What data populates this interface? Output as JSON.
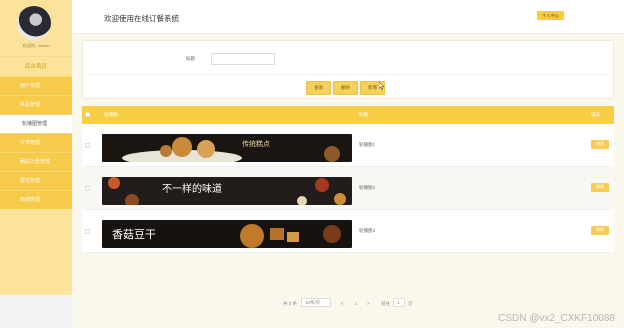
{
  "sidebar": {
    "profile_name": "欢迎你，admin",
    "home_label": "后台首页",
    "items": [
      {
        "label": "用户管理"
      },
      {
        "label": "菜品管理"
      },
      {
        "label": "轮播图管理"
      },
      {
        "label": "订单管理"
      },
      {
        "label": "网站公告管理"
      },
      {
        "label": "留言管理"
      },
      {
        "label": "商城管理"
      }
    ]
  },
  "header": {
    "title": "欢迎使用在线订餐系统",
    "user_center": "个人中心"
  },
  "search": {
    "label": "标题",
    "value": "",
    "buttons": {
      "query": "查询",
      "delete": "删除",
      "add": "新增"
    }
  },
  "table": {
    "columns": [
      "",
      "轮播图",
      "标题",
      "操作"
    ],
    "rows": [
      {
        "title": "轮播图1",
        "op": "修改"
      },
      {
        "title": "轮播图2",
        "op": "修改"
      },
      {
        "title": "轮播图3",
        "op": "修改"
      }
    ]
  },
  "pager": {
    "total": "共 3 条",
    "page_size": "10条/页",
    "prev": "<",
    "current": "1",
    "next": ">",
    "goto_label": "前往",
    "goto_value": "1",
    "page_unit": "页"
  },
  "banners": [
    {
      "text": "传统糕点"
    },
    {
      "text": "不一样的味道"
    },
    {
      "text": "香菇豆干"
    }
  ],
  "watermark": "CSDN @vx2_CXKF10088",
  "colors": {
    "accent": "#f7ce45",
    "sidebar": "#fbe39b",
    "button": "#f7d25a"
  }
}
